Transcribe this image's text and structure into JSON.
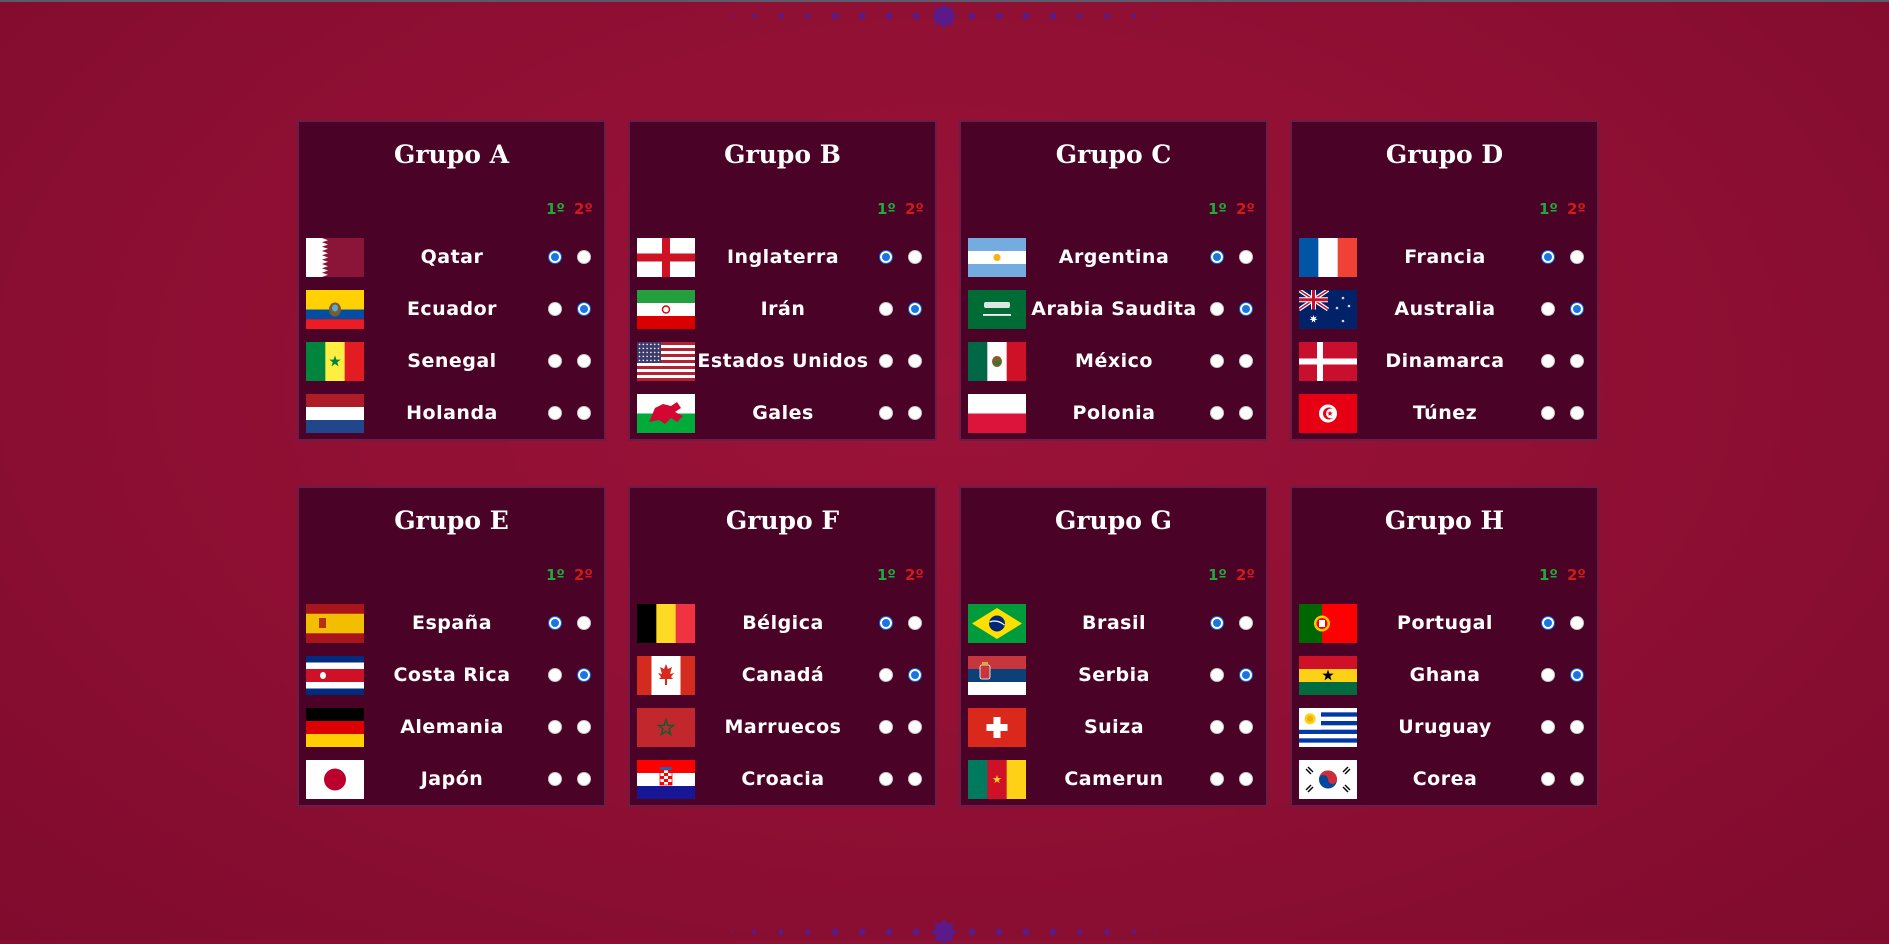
{
  "rank_labels": {
    "first": "1º",
    "second": "2º"
  },
  "colors": {
    "background": "#8e0f33",
    "card": "#4a0226",
    "first": "#1eab3c",
    "second": "#d11a1a",
    "radio_selected": "#1a73e8"
  },
  "groups": [
    {
      "title": "Grupo A",
      "teams": [
        {
          "name": "Qatar",
          "flag": "qatar-flag",
          "first": true,
          "second": false
        },
        {
          "name": "Ecuador",
          "flag": "ecuador-flag",
          "first": false,
          "second": true
        },
        {
          "name": "Senegal",
          "flag": "senegal-flag",
          "first": false,
          "second": false
        },
        {
          "name": "Holanda",
          "flag": "netherlands-flag",
          "first": false,
          "second": false
        }
      ]
    },
    {
      "title": "Grupo B",
      "teams": [
        {
          "name": "Inglaterra",
          "flag": "england-flag",
          "first": true,
          "second": false
        },
        {
          "name": "Irán",
          "flag": "iran-flag",
          "first": false,
          "second": true
        },
        {
          "name": "Estados Unidos",
          "flag": "usa-flag",
          "first": false,
          "second": false
        },
        {
          "name": "Gales",
          "flag": "wales-flag",
          "first": false,
          "second": false
        }
      ]
    },
    {
      "title": "Grupo C",
      "teams": [
        {
          "name": "Argentina",
          "flag": "argentina-flag",
          "first": true,
          "second": false
        },
        {
          "name": "Arabia Saudita",
          "flag": "saudi-arabia-flag",
          "first": false,
          "second": true
        },
        {
          "name": "México",
          "flag": "mexico-flag",
          "first": false,
          "second": false
        },
        {
          "name": "Polonia",
          "flag": "poland-flag",
          "first": false,
          "second": false
        }
      ]
    },
    {
      "title": "Grupo D",
      "teams": [
        {
          "name": "Francia",
          "flag": "france-flag",
          "first": true,
          "second": false
        },
        {
          "name": "Australia",
          "flag": "australia-flag",
          "first": false,
          "second": true
        },
        {
          "name": "Dinamarca",
          "flag": "denmark-flag",
          "first": false,
          "second": false
        },
        {
          "name": "Túnez",
          "flag": "tunisia-flag",
          "first": false,
          "second": false
        }
      ]
    },
    {
      "title": "Grupo E",
      "teams": [
        {
          "name": "España",
          "flag": "spain-flag",
          "first": true,
          "second": false
        },
        {
          "name": "Costa Rica",
          "flag": "costa-rica-flag",
          "first": false,
          "second": true
        },
        {
          "name": "Alemania",
          "flag": "germany-flag",
          "first": false,
          "second": false
        },
        {
          "name": "Japón",
          "flag": "japan-flag",
          "first": false,
          "second": false
        }
      ]
    },
    {
      "title": "Grupo F",
      "teams": [
        {
          "name": "Bélgica",
          "flag": "belgium-flag",
          "first": true,
          "second": false
        },
        {
          "name": "Canadá",
          "flag": "canada-flag",
          "first": false,
          "second": true
        },
        {
          "name": "Marruecos",
          "flag": "morocco-flag",
          "first": false,
          "second": false
        },
        {
          "name": "Croacia",
          "flag": "croatia-flag",
          "first": false,
          "second": false
        }
      ]
    },
    {
      "title": "Grupo G",
      "teams": [
        {
          "name": "Brasil",
          "flag": "brazil-flag",
          "first": true,
          "second": false
        },
        {
          "name": "Serbia",
          "flag": "serbia-flag",
          "first": false,
          "second": true
        },
        {
          "name": "Suiza",
          "flag": "switzerland-flag",
          "first": false,
          "second": false
        },
        {
          "name": "Camerun",
          "flag": "cameroon-flag",
          "first": false,
          "second": false
        }
      ]
    },
    {
      "title": "Grupo H",
      "teams": [
        {
          "name": "Portugal",
          "flag": "portugal-flag",
          "first": true,
          "second": false
        },
        {
          "name": "Ghana",
          "flag": "ghana-flag",
          "first": false,
          "second": true
        },
        {
          "name": "Uruguay",
          "flag": "uruguay-flag",
          "first": false,
          "second": false
        },
        {
          "name": "Corea",
          "flag": "korea-flag",
          "first": false,
          "second": false
        }
      ]
    }
  ]
}
